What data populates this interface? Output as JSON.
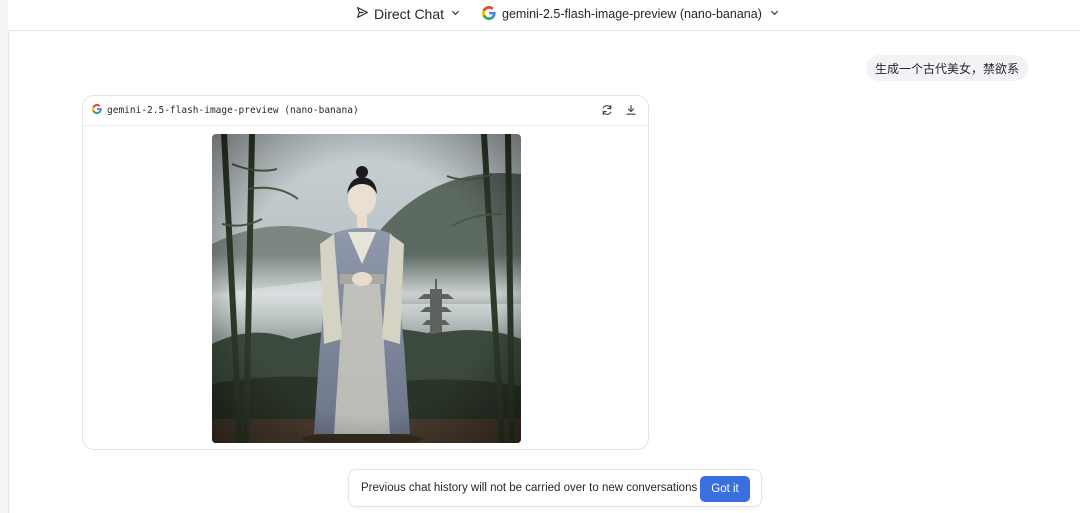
{
  "header": {
    "mode_label": "Direct Chat",
    "mode_icon": "send-icon",
    "model_label": "gemini-2.5-flash-image-preview (nano-banana)",
    "model_icon": "google-g-icon"
  },
  "conversation": {
    "user_message": "生成一个古代美女，禁欲系",
    "response": {
      "model_label": "gemini-2.5-flash-image-preview (nano-banana)",
      "actions": [
        "regenerate-icon",
        "download-icon"
      ],
      "image_alt": "Generated image: woman in ancient Hanfu robes standing in misty bamboo forest with a pagoda in the background"
    }
  },
  "toast": {
    "message": "Previous chat history will not be carried over to new conversations",
    "button_label": "Got it"
  },
  "colors": {
    "accent": "#3b6fde",
    "user_bubble": "#f1f3f6",
    "border": "#e4e4e7"
  }
}
